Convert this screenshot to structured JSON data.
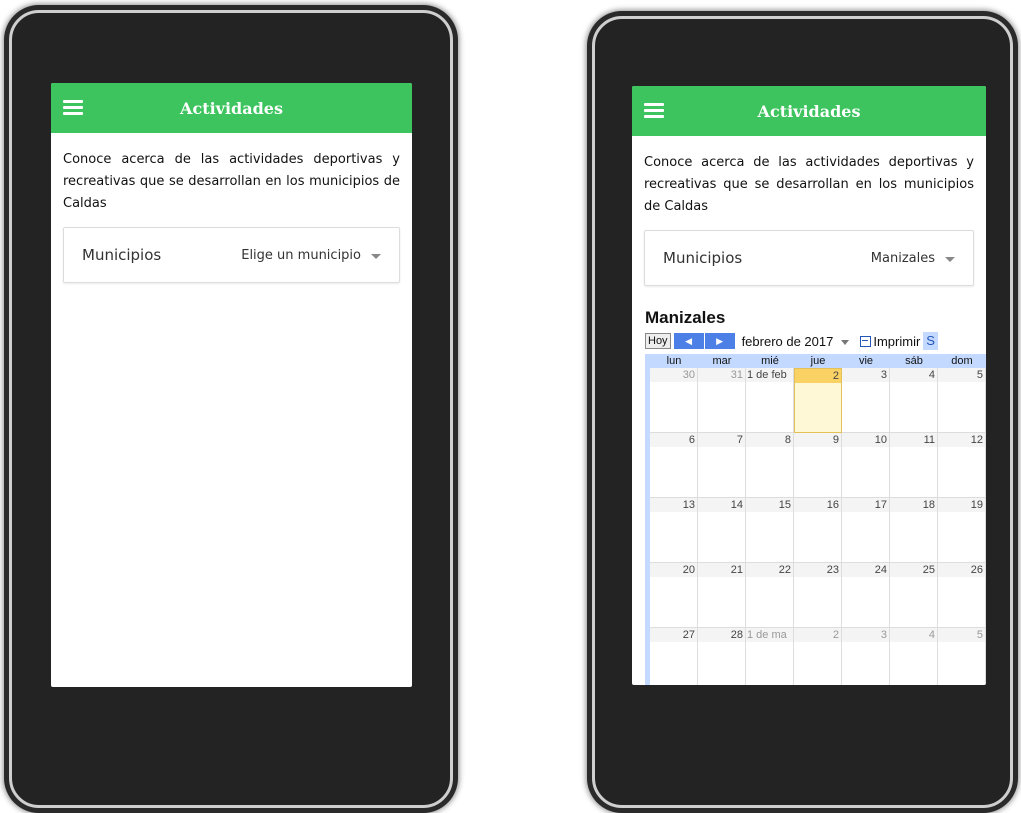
{
  "left_screen": {
    "app_title": "Actividades",
    "intro_text": "Conoce acerca de las actividades deportivas y recreativas que se desarrollan en los municipios de Caldas",
    "select_label": "Municipios",
    "select_value": "Elige un municipio"
  },
  "right_screen": {
    "app_title": "Actividades",
    "intro_text": "Conoce acerca de las actividades deportivas y recreativas que se desarrollan en los municipios de Caldas",
    "select_label": "Municipios",
    "select_value": "Manizales",
    "calendar": {
      "title": "Manizales",
      "today_label": "Hoy",
      "prev_label": "◀",
      "next_label": "▶",
      "month_label": "febrero de 2017",
      "print_label": "Imprimir",
      "tab_label": "S",
      "weekdays": [
        "lun",
        "mar",
        "mié",
        "jue",
        "vie",
        "sáb",
        "dom"
      ],
      "weeks": [
        [
          "30",
          "31",
          "1 de feb",
          "2",
          "3",
          "4",
          "5"
        ],
        [
          "6",
          "7",
          "8",
          "9",
          "10",
          "11",
          "12"
        ],
        [
          "13",
          "14",
          "15",
          "16",
          "17",
          "18",
          "19"
        ],
        [
          "20",
          "21",
          "22",
          "23",
          "24",
          "25",
          "26"
        ],
        [
          "27",
          "28",
          "1 de ma",
          "2",
          "3",
          "4",
          "5"
        ]
      ],
      "today": "2"
    }
  },
  "colors": {
    "appbar": "#3dc45e",
    "calendar_header": "#c3d9ff",
    "nav_button": "#4d80e6",
    "today_highlight": "#fad163"
  }
}
